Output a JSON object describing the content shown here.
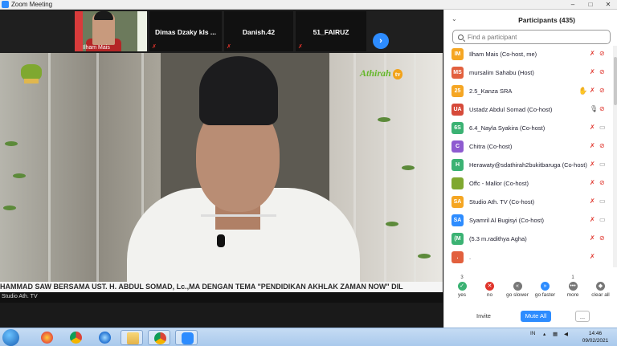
{
  "window": {
    "title": "Zoom Meeting",
    "controls": [
      "–",
      "□",
      "✕"
    ]
  },
  "strip": {
    "tiles": [
      {
        "kind": "video",
        "name": "Ilham Mais"
      },
      {
        "kind": "name",
        "name": "Dimas Dzaky kls ..."
      },
      {
        "kind": "name",
        "name": "Danish.42"
      },
      {
        "kind": "name",
        "name": "51_FAIRUZ"
      }
    ],
    "next_icon": "chevron-right-icon"
  },
  "main_video": {
    "watermark": "Athirah",
    "watermark_tv": "tv",
    "ticker": "HAMMAD SAW BERSAMA UST. H. ABDUL SOMAD, Lc.,MA DENGAN TEMA \"PENDIDIKAN AKHLAK ZAMAN NOW\" DIL",
    "source_label": "Studio Ath. TV"
  },
  "participants": {
    "title": "Participants (435)",
    "search_placeholder": "Find a participant",
    "list": [
      {
        "initials": "IM",
        "color": "#f5a623",
        "name": "Ilham Mais (Co-host, me)",
        "mic": "muted",
        "cam": "off-muted",
        "hand": false
      },
      {
        "initials": "MS",
        "color": "#e2603e",
        "name": "mursalim Sahabu (Host)",
        "mic": "muted",
        "cam": "off",
        "hand": false
      },
      {
        "initials": "25",
        "color": "#f5a623",
        "name": "2.5_Kanza SRA",
        "mic": "muted",
        "cam": "off",
        "hand": true
      },
      {
        "initials": "UA",
        "color": "#d64a3a",
        "name": "Ustadz Abdul Somad (Co-host)",
        "mic": "on",
        "cam": "off",
        "hand": false
      },
      {
        "initials": "6S",
        "color": "#3bb273",
        "name": "6.4_Nayla Syakira (Co-host)",
        "mic": "muted",
        "cam": "video",
        "hand": false
      },
      {
        "initials": "C",
        "color": "#8e5bd0",
        "name": "Chitra (Co-host)",
        "mic": "muted",
        "cam": "off",
        "hand": false
      },
      {
        "initials": "H",
        "color": "#3bb273",
        "name": "Herawaty@sdathirah2bukitbaruga (Co-host)",
        "mic": "muted",
        "cam": "video",
        "hand": false
      },
      {
        "initials": "",
        "color": "#7fa830",
        "name": "Offc - Mallor (Co-host)",
        "mic": "muted",
        "cam": "off",
        "hand": false,
        "logo": true
      },
      {
        "initials": "SA",
        "color": "#f5a623",
        "name": "Studio Ath. TV (Co-host)",
        "mic": "muted",
        "cam": "video",
        "hand": false
      },
      {
        "initials": "SA",
        "color": "#2d8cff",
        "name": "Syamril Al Bugisyi (Co-host)",
        "mic": "muted",
        "cam": "video",
        "hand": false
      },
      {
        "initials": "(M",
        "color": "#3bb273",
        "name": "(5.3 m.radithya Agha)",
        "mic": "muted",
        "cam": "off",
        "hand": false
      },
      {
        "initials": ".",
        "color": "#e2603e",
        "name": ".",
        "mic": "muted",
        "cam": "none",
        "hand": false
      }
    ],
    "reactions": [
      {
        "count": "3",
        "label": "yes",
        "color": "#3bb273",
        "glyph": "✓",
        "icon": "yes-icon"
      },
      {
        "count": "",
        "label": "no",
        "color": "#e0342b",
        "glyph": "✕",
        "icon": "no-icon"
      },
      {
        "count": "",
        "label": "go slower",
        "color": "#777777",
        "glyph": "«",
        "icon": "go-slower-icon"
      },
      {
        "count": "",
        "label": "go faster",
        "color": "#2d8cff",
        "glyph": "»",
        "icon": "go-faster-icon"
      },
      {
        "count": "1",
        "label": "more",
        "color": "#777777",
        "glyph": "•••",
        "icon": "more-icon"
      },
      {
        "count": "",
        "label": "clear all",
        "color": "#777777",
        "glyph": "◆",
        "icon": "clear-all-icon"
      }
    ],
    "buttons": {
      "invite": "Invite",
      "mute_all": "Mute All",
      "more": "..."
    }
  },
  "taskbar": {
    "tray_lang": "IN",
    "time": "14:46",
    "date": "09/02/2021"
  }
}
